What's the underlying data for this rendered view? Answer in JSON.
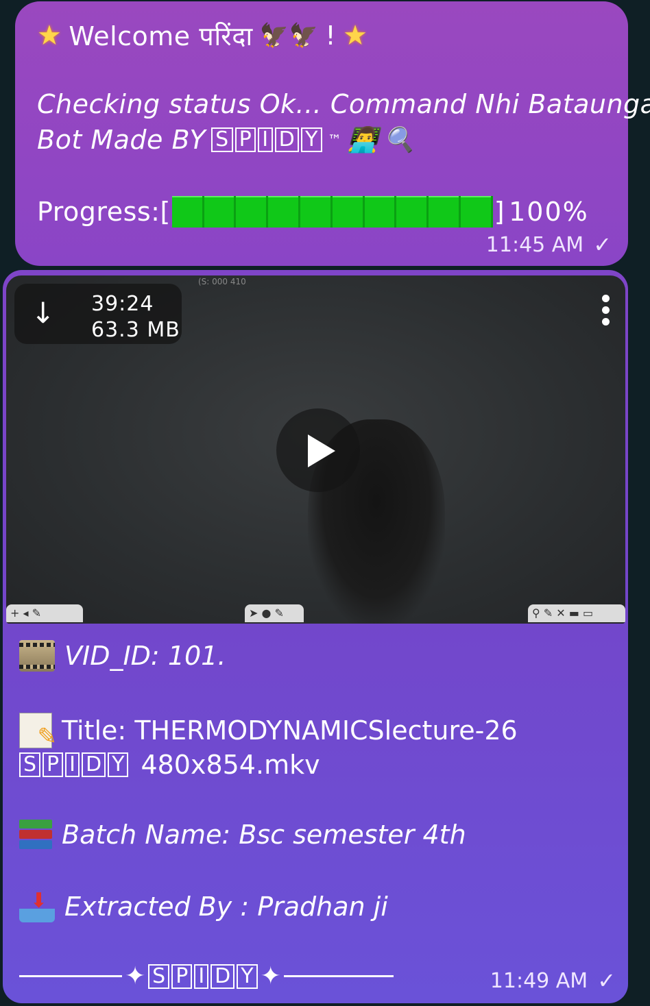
{
  "message1": {
    "welcome_text": "Welcome परिंदा",
    "exclaim": "!",
    "line1": "Checking status Ok... Command Nhi Bataunga",
    "line2_prefix": "Bot Made BY",
    "brand_letters": [
      "S",
      "P",
      "I",
      "D",
      "Y"
    ],
    "trademark": "™",
    "progress_label": "Progress:[",
    "progress_close": "]",
    "progress_percent": "100%",
    "progress_value": 1.0,
    "progress_segments": 10,
    "time": "11:45 AM"
  },
  "message2": {
    "video": {
      "duration": "39:24",
      "size": "63.3 MB",
      "top_code": "(S: 000 410"
    },
    "vid_id_label": "VID_ID: 101.",
    "title_label": "Title: THERMODYNAMICSlecture-26",
    "title_suffix": "480x854.mkv",
    "brand_letters": [
      "S",
      "P",
      "I",
      "D",
      "Y"
    ],
    "batch_label": "Batch Name: Bsc semester 4th",
    "extracted_label": "Extracted By : Pradhan ji",
    "time": "11:49 AM"
  },
  "icons": {
    "read_check": "check-icon",
    "download": "download-arrow-icon",
    "menu": "more-vert-icon",
    "play": "play-icon"
  },
  "colors": {
    "bubble1": "#9a48bf",
    "bubble2": "#7445c9",
    "progress_green": "#10c818",
    "background": "#0f1f25"
  }
}
